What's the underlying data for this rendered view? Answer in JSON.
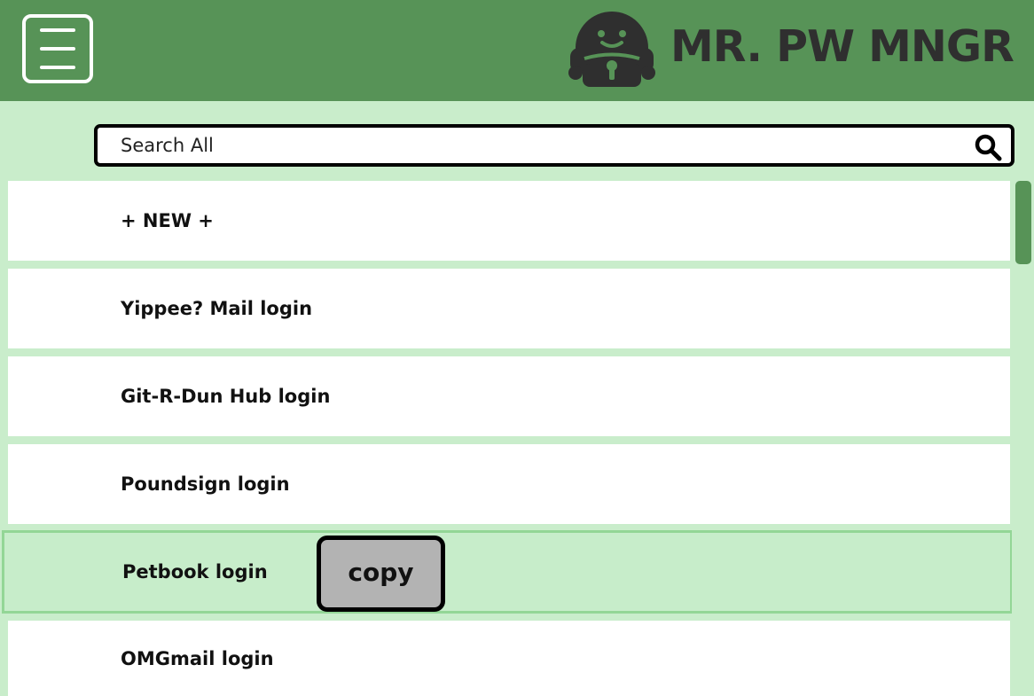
{
  "app": {
    "title": "MR. PW MNGR"
  },
  "header": {
    "menu_icon": "hamburger-menu-icon",
    "logo_icon": "lock-robot-icon"
  },
  "search": {
    "placeholder": "Search All",
    "value": "",
    "icon": "search-icon"
  },
  "list": {
    "items": [
      {
        "label": "+ NEW +"
      },
      {
        "label": "Yippee? Mail login"
      },
      {
        "label": "Git-R-Dun Hub login"
      },
      {
        "label": "Poundsign login"
      },
      {
        "label": "Petbook login",
        "selected": true
      },
      {
        "label": "OMGmail login"
      }
    ],
    "copy_label": "copy"
  },
  "colors": {
    "header_bg": "#579357",
    "page_bg": "#c9edcb",
    "selected_row_bg": "#c7edca",
    "brand_text": "#2f2f2f",
    "copy_button_bg": "#b3b3b3"
  }
}
